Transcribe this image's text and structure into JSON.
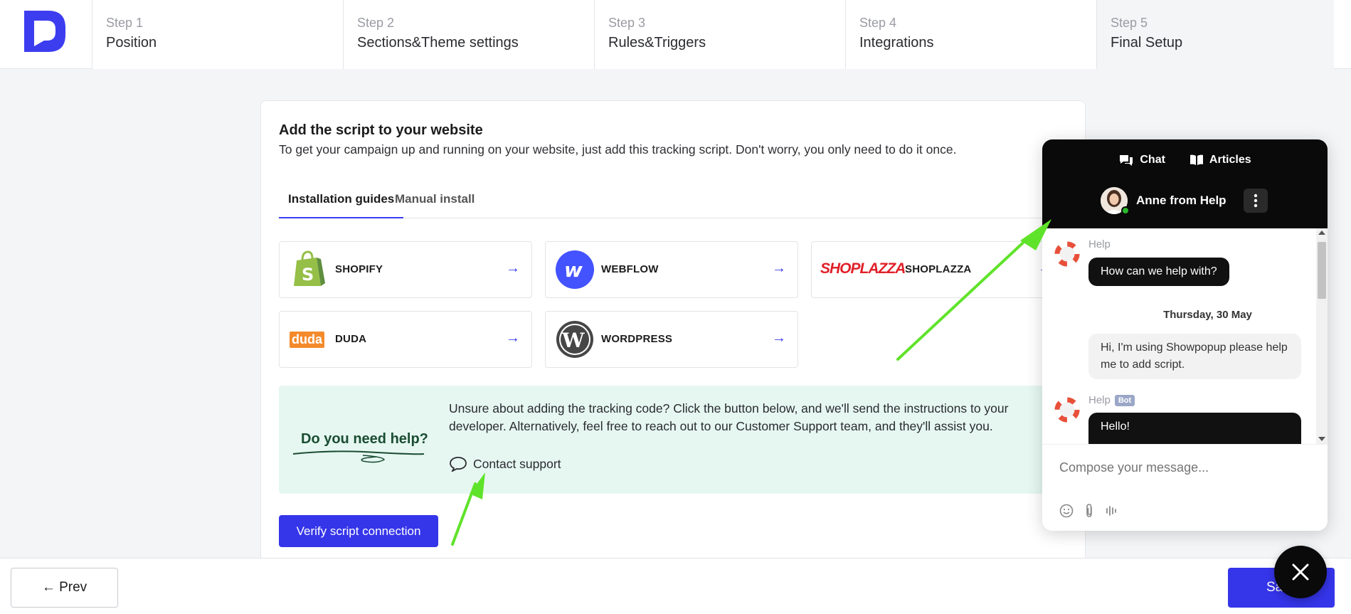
{
  "steps": [
    {
      "num": "Step 1",
      "name": "Position"
    },
    {
      "num": "Step 2",
      "name": "Sections&Theme settings"
    },
    {
      "num": "Step 3",
      "name": "Rules&Triggers"
    },
    {
      "num": "Step 4",
      "name": "Integrations"
    },
    {
      "num": "Step 5",
      "name": "Final Setup"
    }
  ],
  "card": {
    "title": "Add the script to your website",
    "subtitle": "To get your campaign up and running on your website, just add this tracking script. Don't worry, you only need to do it once.",
    "tabs": [
      "Installation guides",
      "Manual install"
    ],
    "platforms": [
      {
        "label": "SHOPIFY",
        "arrow": "→"
      },
      {
        "label": "WEBFLOW",
        "arrow": "→"
      },
      {
        "label": "SHOPLAZZA",
        "arrow": "→",
        "logo_text": "SHOPLAZZA"
      },
      {
        "label": "DUDA",
        "arrow": "→",
        "logo_text": "duda"
      },
      {
        "label": "WORDPRESS",
        "arrow": "→"
      }
    ],
    "help": {
      "title": "Do you need help?",
      "text": "Unsure about adding the tracking code? Click the button below, and we'll send the instructions to your developer. Alternatively, feel free to reach out to our Customer Support team, and they'll assist you.",
      "contact_label": "Contact support"
    },
    "verify_label": "Verify script connection"
  },
  "footer": {
    "prev_label": "← Prev",
    "save_label": "Save"
  },
  "chat": {
    "tabs": [
      {
        "label": "Chat",
        "icon": "chat-bubbles-icon"
      },
      {
        "label": "Articles",
        "icon": "book-icon"
      }
    ],
    "agent_name": "Anne from Help",
    "messages": [
      {
        "sender": "Help",
        "text": "How can we help with?"
      },
      {
        "date": "Thursday, 30 May"
      },
      {
        "text": "Hi, I'm using Showpopup please help me to add script."
      },
      {
        "sender": "Help",
        "badge": "Bot",
        "text": "Hello!"
      }
    ],
    "compose_placeholder": "Compose your message..."
  },
  "colors": {
    "accent": "#3535ea",
    "help_bg": "#e6f7f1",
    "annotation_arrow": "#5fe32a"
  }
}
